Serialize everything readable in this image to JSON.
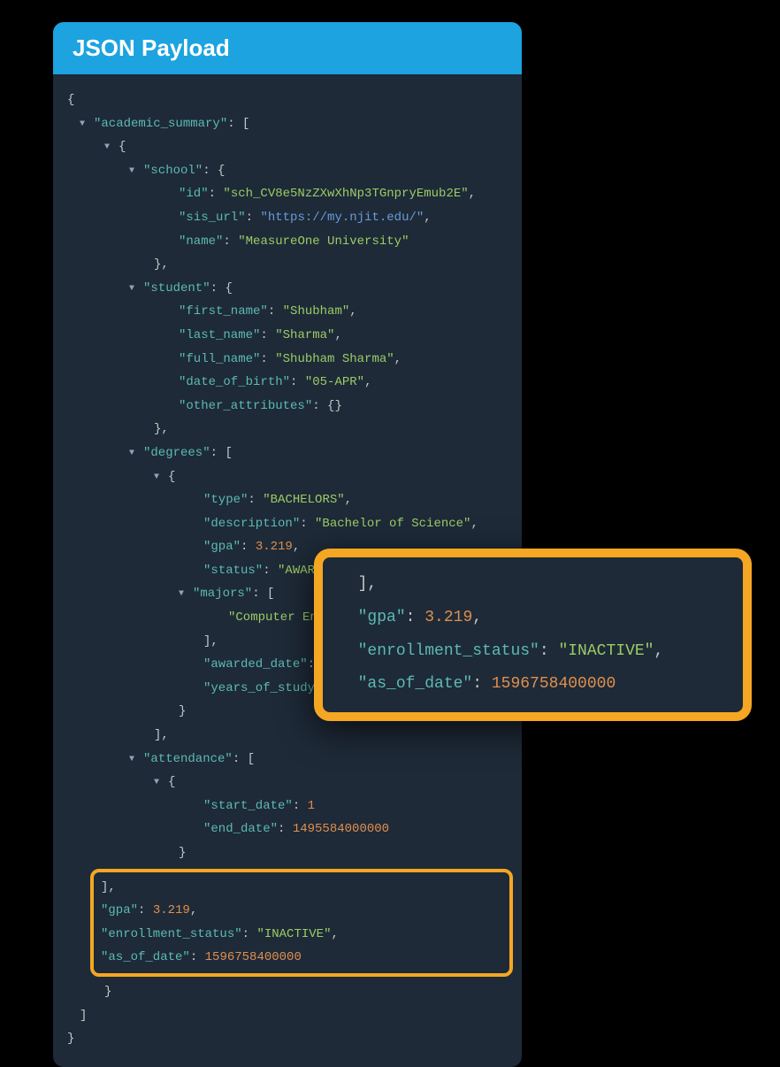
{
  "header": {
    "title": "JSON Payload"
  },
  "json": {
    "root_open": "{",
    "root_close": "}",
    "academic_summary_key": "\"academic_summary\"",
    "bracket_open": "[",
    "bracket_close": "]",
    "brace_open": "{",
    "brace_close": "}",
    "comma": ",",
    "colon": ": ",
    "school": {
      "key": "\"school\"",
      "id_key": "\"id\"",
      "id_val": "\"sch_CV8e5NzZXwXhNp3TGnpryEmub2E\"",
      "sis_url_key": "\"sis_url\"",
      "sis_url_val": "\"https://my.njit.edu/\"",
      "name_key": "\"name\"",
      "name_val": "\"MeasureOne University\""
    },
    "student": {
      "key": "\"student\"",
      "first_key": "\"first_name\"",
      "first_val": "\"Shubham\"",
      "last_key": "\"last_name\"",
      "last_val": "\"Sharma\"",
      "full_key": "\"full_name\"",
      "full_val": "\"Shubham Sharma\"",
      "dob_key": "\"date_of_birth\"",
      "dob_val": "\"05-APR\"",
      "other_key": "\"other_attributes\"",
      "other_val": "{}"
    },
    "degrees": {
      "key": "\"degrees\"",
      "type_key": "\"type\"",
      "type_val": "\"BACHELORS\"",
      "desc_key": "\"description\"",
      "desc_val": "\"Bachelor of Science\"",
      "gpa_key": "\"gpa\"",
      "gpa_val": "3.219",
      "status_key": "\"status\"",
      "status_val": "\"AWARDED\"",
      "majors_key": "\"majors\"",
      "majors_val": "\"Computer Engineering\"",
      "awarded_key": "\"awarded_date\"",
      "yos_key": "\"years_of_study\""
    },
    "attendance": {
      "key": "\"attendance\"",
      "start_key": "\"start_date\"",
      "start_val": "1",
      "end_key": "\"end_date\"",
      "end_val": "1495584000000"
    },
    "summary": {
      "gpa_key": "\"gpa\"",
      "gpa_val": "3.219",
      "enroll_key": "\"enrollment_status\"",
      "enroll_val": "\"INACTIVE\"",
      "asof_key": "\"as_of_date\"",
      "asof_val": "1596758400000"
    }
  },
  "zoom": {
    "close_bracket": "],",
    "gpa_key": "\"gpa\"",
    "gpa_val": "3.219",
    "enroll_key": "\"enrollment_status\"",
    "enroll_val": "\"INACTIVE\"",
    "asof_key": "\"as_of_date\"",
    "asof_val": "1596758400000"
  }
}
